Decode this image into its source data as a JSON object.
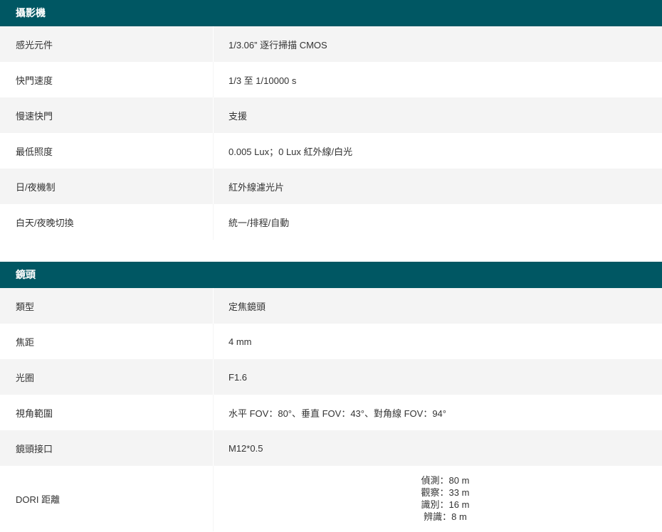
{
  "sections": [
    {
      "title": "攝影機",
      "rows": [
        {
          "label": "感光元件",
          "value": "1/3.06” 逐行掃描 CMOS"
        },
        {
          "label": "快門速度",
          "value": "1/3 至 1/10000 s"
        },
        {
          "label": "慢速快門",
          "value": "支援"
        },
        {
          "label": "最低照度",
          "value": "0.005 Lux；0 Lux 紅外線/白光"
        },
        {
          "label": "日/夜機制",
          "value": "紅外線濾光片"
        },
        {
          "label": "白天/夜晚切換",
          "value": "統一/排程/自動"
        }
      ]
    },
    {
      "title": "鏡頭",
      "rows": [
        {
          "label": "類型",
          "value": "定焦鏡頭"
        },
        {
          "label": "焦距",
          "value": "4 mm"
        },
        {
          "label": "光圈",
          "value": "F1.6"
        },
        {
          "label": "視角範圍",
          "value": "水平 FOV：80°、垂直 FOV：43°、對角線 FOV：94°"
        },
        {
          "label": "鏡頭接口",
          "value": "M12*0.5"
        },
        {
          "label": "DORI 距離",
          "lines": [
            "偵測：80 m",
            "觀察：33 m",
            "識別：16 m",
            "辨識：8 m"
          ]
        }
      ]
    }
  ]
}
